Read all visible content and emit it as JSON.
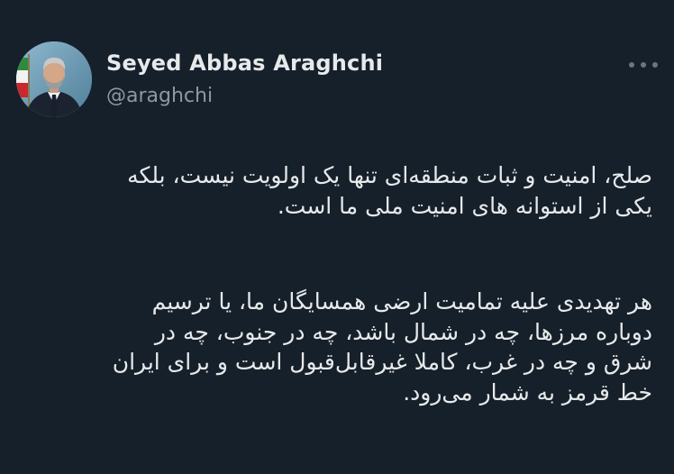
{
  "author": {
    "display_name": "Seyed Abbas Araghchi",
    "handle": "@araghchi",
    "avatar_icon": "profile-photo-icon"
  },
  "menu": {
    "icon": "more-options-icon"
  },
  "tweet": {
    "paragraphs": [
      {
        "lines": [
          "صلح، امنیت و ثبات منطقه‌ای تنها یک اولویت نیست، بلکه",
          "یکی از استوانه های امنیت ملی ما است."
        ]
      },
      {
        "lines": [
          "هر تهدیدی علیه تمامیت ارضی همسایگان ما، یا ترسیم",
          "دوباره مرزها، چه در شمال باشد، چه در جنوب، چه در",
          "شرق و چه در غرب، کاملا غیرقابل‌قبول است و برای ایران",
          "خط قرمز  به شمار می‌رود."
        ]
      }
    ]
  },
  "colors": {
    "background": "#15202b",
    "text": "#e7e9ea",
    "secondary_text": "#8b98a5"
  }
}
